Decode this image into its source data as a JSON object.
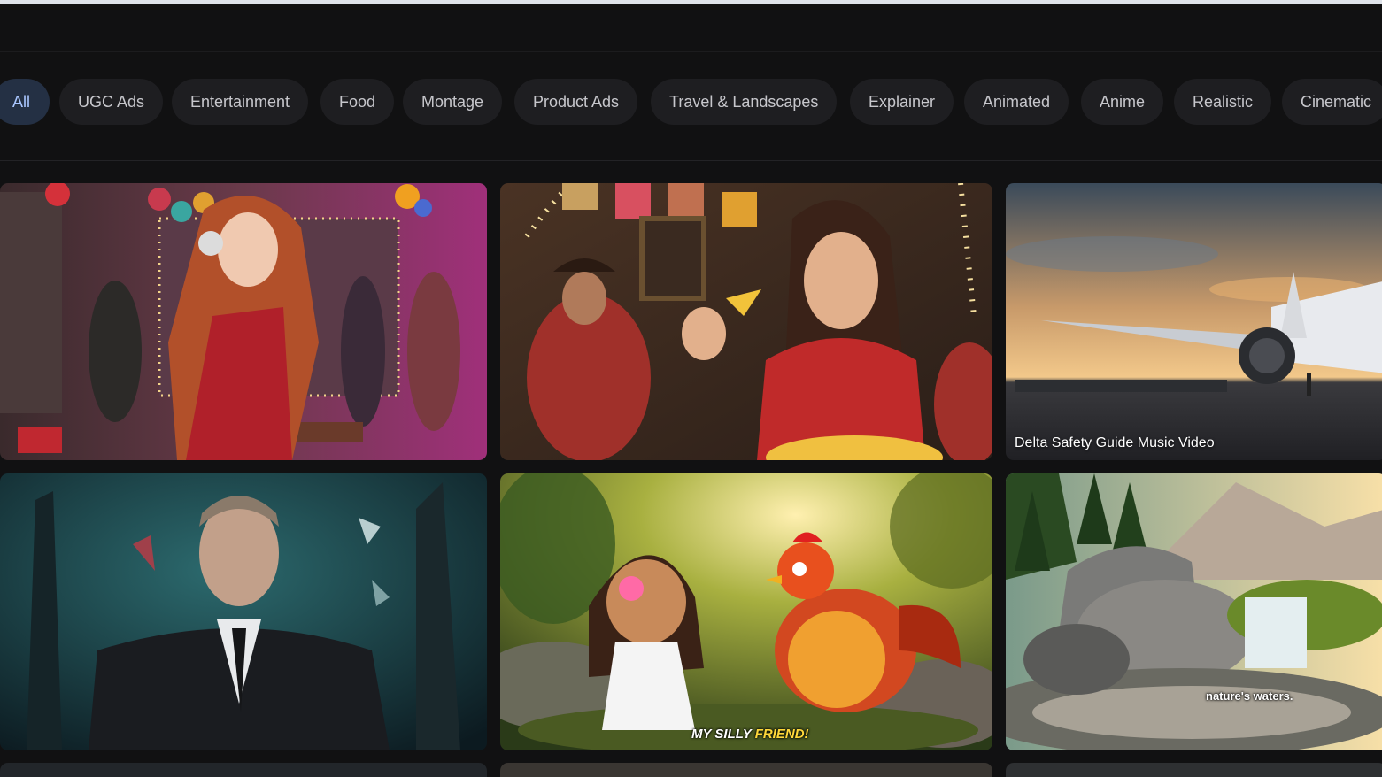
{
  "filters": {
    "chips": [
      "All",
      "UGC Ads",
      "Entertainment",
      "Food",
      "Montage",
      "Product Ads",
      "Travel & Landscapes",
      "Explainer",
      "Animated",
      "Anime",
      "Realistic",
      "Cinematic"
    ],
    "active": "All",
    "colors": {
      "chip_bg": "#1e1e21",
      "chip_text": "#c7c7cc",
      "active_bg": "#243044",
      "active_text": "#a9c6ff"
    }
  },
  "gallery": {
    "cards": [
      {
        "id": "party-headphones",
        "caption": "",
        "subtitle": ""
      },
      {
        "id": "chip-fiesta",
        "caption": "",
        "subtitle": ""
      },
      {
        "id": "airplane-sunset",
        "caption": "Delta Safety Guide Music Video",
        "subtitle": ""
      },
      {
        "id": "agent-suit",
        "caption": "",
        "subtitle": ""
      },
      {
        "id": "girl-rooster",
        "caption": "",
        "subtitle_prefix": "MY SILLY ",
        "subtitle_highlight": "FRIEND!"
      },
      {
        "id": "waterfall",
        "caption": "",
        "subtitle": "nature's waters."
      }
    ]
  }
}
